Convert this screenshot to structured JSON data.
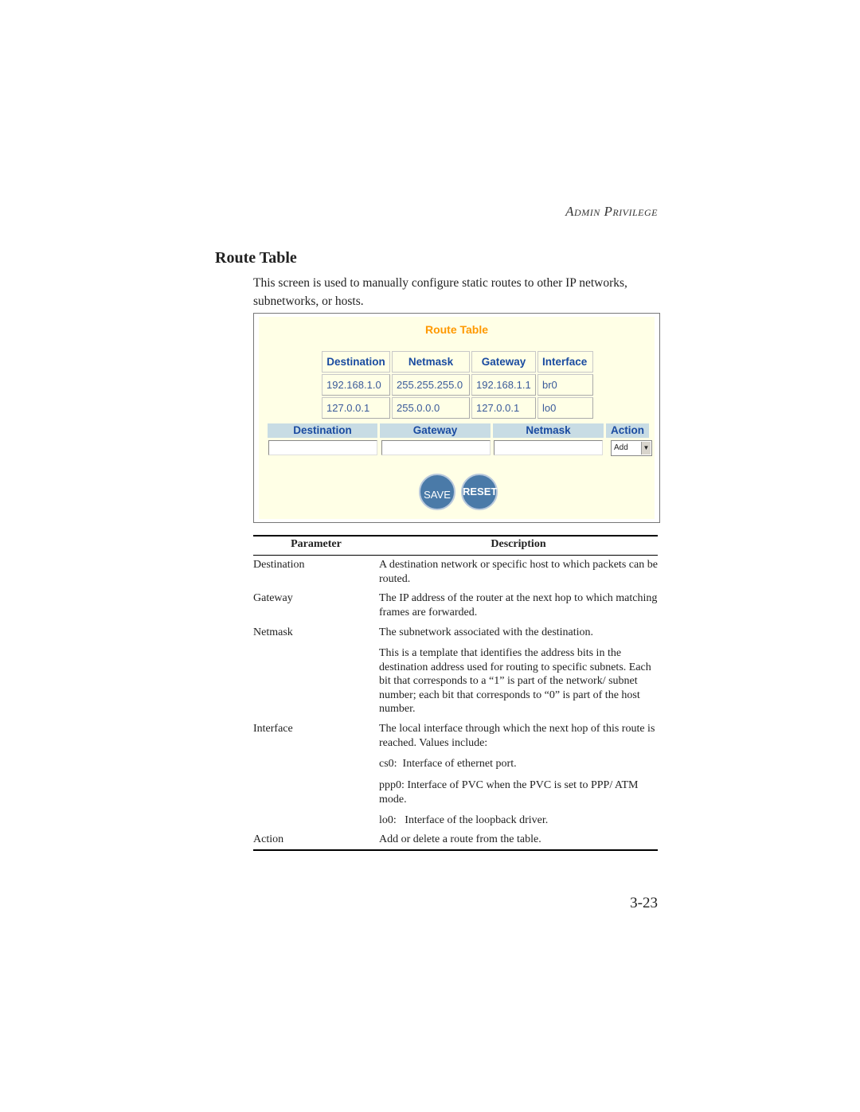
{
  "running_head": "Admin Privilege",
  "section_title": "Route Table",
  "intro": "This screen is used to manually configure static routes to other IP networks, subnetworks, or hosts.",
  "screenshot": {
    "title": "Route Table",
    "title_color": "#ff9900",
    "route_table": {
      "headers": [
        "Destination",
        "Netmask",
        "Gateway",
        "Interface"
      ],
      "rows": [
        [
          "192.168.1.0",
          "255.255.255.0",
          "192.168.1.1",
          "br0"
        ],
        [
          "127.0.0.1",
          "255.0.0.0",
          "127.0.0.1",
          "lo0"
        ]
      ]
    },
    "form": {
      "headers": [
        "Destination",
        "Gateway",
        "Netmask",
        "Action"
      ],
      "destination_value": "",
      "gateway_value": "",
      "netmask_value": "",
      "action_selected": "Add"
    },
    "save_label": "SAVE",
    "reset_label": "RESET"
  },
  "param_table": {
    "headers": [
      "Parameter",
      "Description"
    ],
    "rows": [
      {
        "param": "Destination",
        "desc": [
          "A destination network or specific host to which packets can be routed."
        ]
      },
      {
        "param": "Gateway",
        "desc": [
          "The IP address of the router at the next hop to which matching frames are forwarded."
        ]
      },
      {
        "param": "Netmask",
        "desc": [
          "The subnetwork associated with the destination.",
          "This is a template that identifies the address bits in the destination address used for routing to specific subnets. Each bit that corresponds to a “1” is part of the network/ subnet number; each bit that corresponds to “0” is part of the host number."
        ]
      },
      {
        "param": "Interface",
        "desc": [
          "The local interface through which the next hop of this route is reached. Values include:",
          "cs0:  Interface of ethernet port.",
          "ppp0: Interface of PVC when the PVC is set to PPP/ ATM mode.",
          "lo0:   Interface of the loopback driver."
        ]
      },
      {
        "param": "Action",
        "desc": [
          "Add or delete a route from the table."
        ]
      }
    ]
  },
  "page_number": "3-23"
}
